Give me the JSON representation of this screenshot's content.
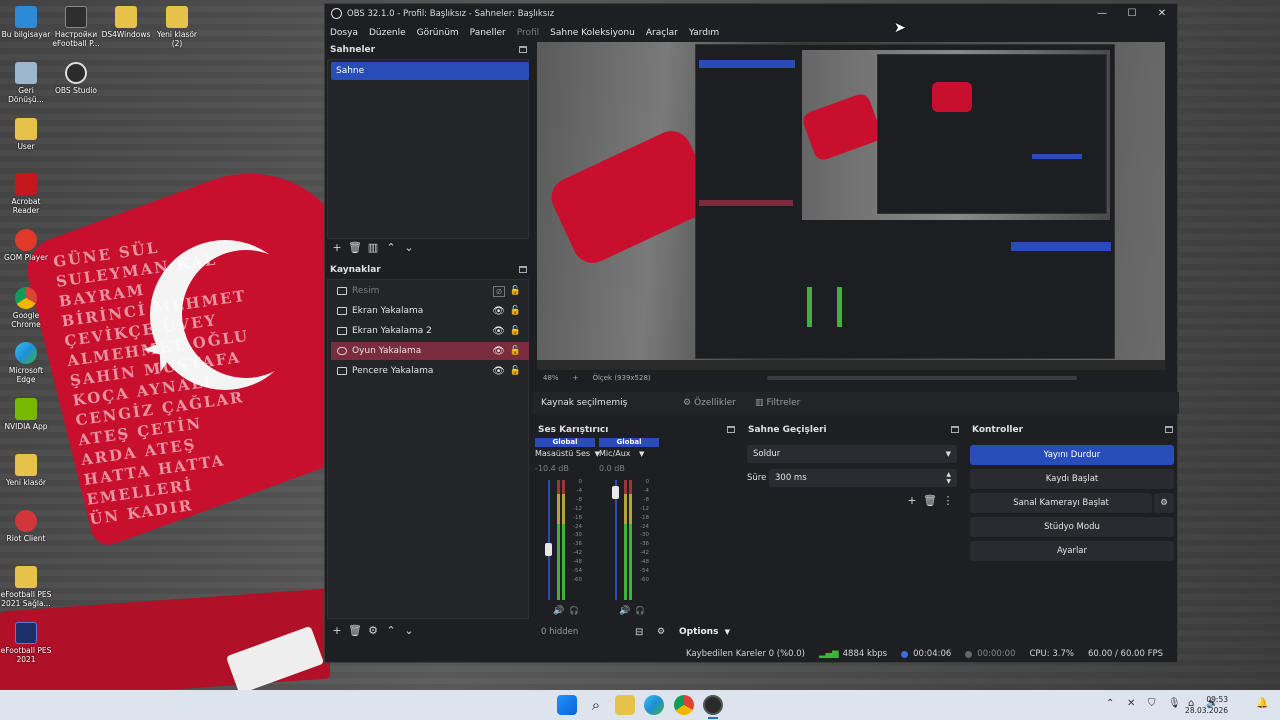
{
  "desktop": {
    "icons": [
      {
        "label": "Bu bilgisayar",
        "color": "#2d8ad6"
      },
      {
        "label": "Настройки eFootball P...",
        "color": "#2e2e2e"
      },
      {
        "label": "DS4Windows",
        "color": "#e7c24a"
      },
      {
        "label": "Yeni klasör (2)",
        "color": "#e7c24a"
      },
      {
        "label": "Geri Dönüşü...",
        "color": "#9cb6d0"
      },
      {
        "label": "OBS Studio",
        "color": "#2b2b2b"
      },
      {
        "label": "User",
        "color": "#e7c24a"
      },
      {
        "label": "Acrobat Reader",
        "color": "#c4161c"
      },
      {
        "label": "GOM Player",
        "color": "#e23a2a"
      },
      {
        "label": "Google Chrome",
        "color": "#3a9a4a"
      },
      {
        "label": "Microsoft Edge",
        "color": "#1f8fd8"
      },
      {
        "label": "NVIDIA App",
        "color": "#76b900"
      },
      {
        "label": "Yeni klasör",
        "color": "#e7c24a"
      },
      {
        "label": "Riot Client",
        "color": "#d1363a"
      },
      {
        "label": "eFootball PES 2021 Sağla...",
        "color": "#e7c24a"
      },
      {
        "label": "eFootball PES 2021",
        "color": "#1b2f6b"
      }
    ],
    "wall_text": "GÜNE SÜL\nSULEYMAN KAL\nBAYRAM\nBİRİNCİ MEHMET\nÇEVİKÇE ÜVEY\nALMEHMET OĞLU\nŞAHİN MUSTAFA\nKOÇA AYNALI\nCENGİZ ÇAĞLAR\nATEŞ ÇETİN\nARDA ATEŞ\nHATTA HATTA\nEMELLERİ\nÜN KADIR"
  },
  "obs": {
    "title": "OBS 32.1.0 - Profil: Başlıksız - Sahneler: Başlıksız",
    "window_buttons": {
      "minimize": "—",
      "maximize": "☐",
      "close": "✕"
    },
    "menu": [
      {
        "label": "Dosya",
        "disabled": false
      },
      {
        "label": "Düzenle",
        "disabled": false
      },
      {
        "label": "Görünüm",
        "disabled": false
      },
      {
        "label": "Paneller",
        "disabled": false
      },
      {
        "label": "Profil",
        "disabled": true
      },
      {
        "label": "Sahne Koleksiyonu",
        "disabled": false
      },
      {
        "label": "Araçlar",
        "disabled": false
      },
      {
        "label": "Yardım",
        "disabled": false
      }
    ],
    "scenes": {
      "title": "Sahneler",
      "items": [
        "Sahne"
      ]
    },
    "sources": {
      "title": "Kaynaklar",
      "items": [
        {
          "label": "Resim",
          "disabled": true,
          "selected": false
        },
        {
          "label": "Ekran Yakalama",
          "disabled": false,
          "selected": false
        },
        {
          "label": "Ekran Yakalama 2",
          "disabled": false,
          "selected": false
        },
        {
          "label": "Oyun Yakalama",
          "disabled": false,
          "selected": true
        },
        {
          "label": "Pencere Yakalama",
          "disabled": false,
          "selected": false
        }
      ]
    },
    "preview_bar": {
      "zoom": "48%",
      "plus": "+",
      "canvas": "Ölçek (939x528)"
    },
    "context": {
      "no_source": "Kaynak seçilmemiş",
      "properties": "Özellikler",
      "filters": "Filtreler"
    },
    "mixer": {
      "title": "Ses Karıştırıcı",
      "channels": [
        {
          "badge": "Global",
          "name": "Masaüstü Ses",
          "db": "-10.4 dB",
          "level": 0.45
        },
        {
          "badge": "Global",
          "name": "Mic/Aux",
          "db": "0.0 dB",
          "level": 0.95
        }
      ],
      "scale": [
        "0",
        "-4",
        "-8",
        "-12",
        "-18",
        "-24",
        "-30",
        "-36",
        "-42",
        "-48",
        "-54",
        "-60"
      ],
      "hidden": "0 hidden",
      "options": "Options"
    },
    "transitions": {
      "title": "Sahne Geçişleri",
      "selected": "Soldur",
      "duration_label": "Süre",
      "duration_value": "300 ms"
    },
    "controls": {
      "title": "Kontroller",
      "buttons": {
        "stop_stream": "Yayını Durdur",
        "start_record": "Kaydı Başlat",
        "virtual_cam": "Sanal Kamerayı Başlat",
        "studio_mode": "Stüdyo Modu",
        "settings": "Ayarlar"
      }
    },
    "status": {
      "dropped_frames": "Kaybedilen Kareler 0 (%0.0)",
      "bitrate": "4884 kbps",
      "stream_time": "00:04:06",
      "record_time": "00:00:00",
      "cpu": "CPU: 3.7%",
      "fps": "60.00 / 60.00 FPS"
    }
  },
  "taskbar": {
    "time": "09:53",
    "date": "28.03.2026"
  },
  "colors": {
    "accent": "#284cb8",
    "selected_source": "#7a2b3c",
    "flag_red": "#c8102e"
  }
}
